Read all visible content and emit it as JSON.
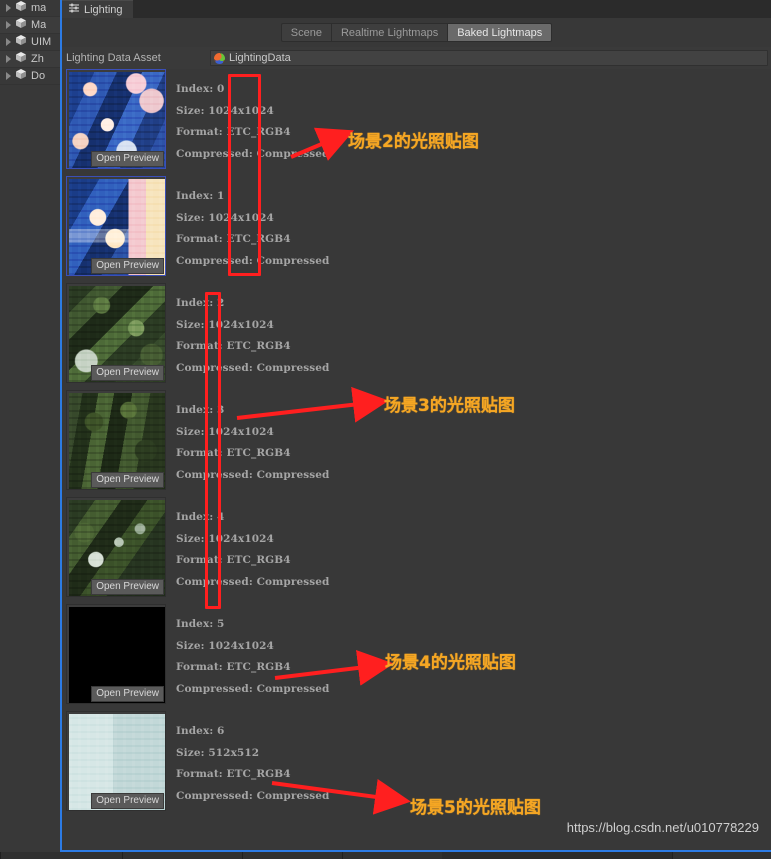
{
  "window": {
    "tab_title": "Lighting",
    "tab_icon": "lighting-settings-icon"
  },
  "hierarchy": {
    "items": [
      {
        "label": "ma",
        "icon": "prefab-cube-icon"
      },
      {
        "label": "Ma",
        "icon": "prefab-cube-icon"
      },
      {
        "label": "UIM",
        "icon": "prefab-cube-icon"
      },
      {
        "label": "Zh",
        "icon": "prefab-cube-icon"
      },
      {
        "label": "Do",
        "icon": "prefab-cube-icon"
      }
    ]
  },
  "toolbar": {
    "tabs": [
      {
        "label": "Scene",
        "active": false
      },
      {
        "label": "Realtime Lightmaps",
        "active": false
      },
      {
        "label": "Baked Lightmaps",
        "active": true
      }
    ]
  },
  "asset_field": {
    "label": "Lighting Data Asset",
    "value": "LightingData",
    "icon": "lighting-data-asset-icon"
  },
  "lightmaps": [
    {
      "index": "Index: 0",
      "size": "Size: 1024x1024",
      "format": "Format: ETC_RGB4",
      "compressed": "Compressed: Compressed",
      "preview_label": "Open Preview",
      "texture": "tex-blue",
      "selected": true
    },
    {
      "index": "Index: 1",
      "size": "Size: 1024x1024",
      "format": "Format: ETC_RGB4",
      "compressed": "Compressed: Compressed",
      "preview_label": "Open Preview",
      "texture": "tex-blue2",
      "selected": false
    },
    {
      "index": "Index: 2",
      "size": "Size: 1024x1024",
      "format": "Format: ETC_RGB4",
      "compressed": "Compressed: Compressed",
      "preview_label": "Open Preview",
      "texture": "tex-green",
      "selected": false
    },
    {
      "index": "Index: 3",
      "size": "Size: 1024x1024",
      "format": "Format: ETC_RGB4",
      "compressed": "Compressed: Compressed",
      "preview_label": "Open Preview",
      "texture": "tex-green2",
      "selected": false
    },
    {
      "index": "Index: 4",
      "size": "Size: 1024x1024",
      "format": "Format: ETC_RGB4",
      "compressed": "Compressed: Compressed",
      "preview_label": "Open Preview",
      "texture": "tex-green3",
      "selected": false
    },
    {
      "index": "Index: 5",
      "size": "Size: 1024x1024",
      "format": "Format: ETC_RGB4",
      "compressed": "Compressed: Compressed",
      "preview_label": "Open Preview",
      "texture": "tex-black",
      "selected": false
    },
    {
      "index": "Index: 6",
      "size": "Size: 512x512",
      "format": "Format: ETC_RGB4",
      "compressed": "Compressed: Compressed",
      "preview_label": "Open Preview",
      "texture": "tex-white",
      "selected": false
    }
  ],
  "annotations": {
    "notes": [
      {
        "text": "场景2的光照贴图"
      },
      {
        "text": "场景3的光照贴图"
      },
      {
        "text": "场景4的光照贴图"
      },
      {
        "text": "场景5的光照贴图"
      }
    ],
    "box_color": "#ff1f1f",
    "note_color": "#f5a623"
  },
  "watermark": "https://blog.csdn.net/u010778229"
}
